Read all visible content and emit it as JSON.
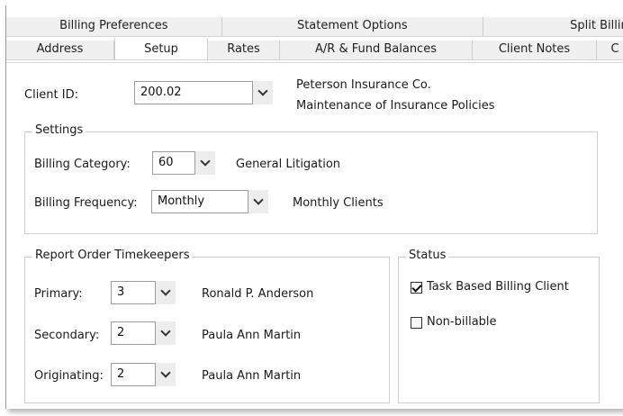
{
  "tabs_row1": [
    {
      "label": "Billing Preferences"
    },
    {
      "label": "Statement Options"
    },
    {
      "label": "Split Billing"
    }
  ],
  "tabs_row2": [
    {
      "label": "Address"
    },
    {
      "label": "Setup",
      "active": true
    },
    {
      "label": "Rates"
    },
    {
      "label": "A/R & Fund Balances"
    },
    {
      "label": "Client Notes"
    },
    {
      "label": "C"
    }
  ],
  "client": {
    "id_label": "Client ID:",
    "id_value": "200.02",
    "name": "Peterson Insurance Co.",
    "matter": "Maintenance of Insurance Policies"
  },
  "settings": {
    "legend": "Settings",
    "billing_category_label": "Billing Category:",
    "billing_category_value": "60",
    "billing_category_desc": "General Litigation",
    "billing_frequency_label": "Billing Frequency:",
    "billing_frequency_value": "Monthly",
    "billing_frequency_desc": "Monthly Clients"
  },
  "timekeepers": {
    "legend": "Report Order Timekeepers",
    "primary_label": "Primary:",
    "primary_value": "3",
    "primary_name": "Ronald P. Anderson",
    "secondary_label": "Secondary:",
    "secondary_value": "2",
    "secondary_name": "Paula Ann Martin",
    "originating_label": "Originating:",
    "originating_value": "2",
    "originating_name": "Paula Ann Martin"
  },
  "status": {
    "legend": "Status",
    "task_based_label": "Task Based Billing Client",
    "task_based_checked": true,
    "non_billable_label": "Non-billable",
    "non_billable_checked": false
  }
}
